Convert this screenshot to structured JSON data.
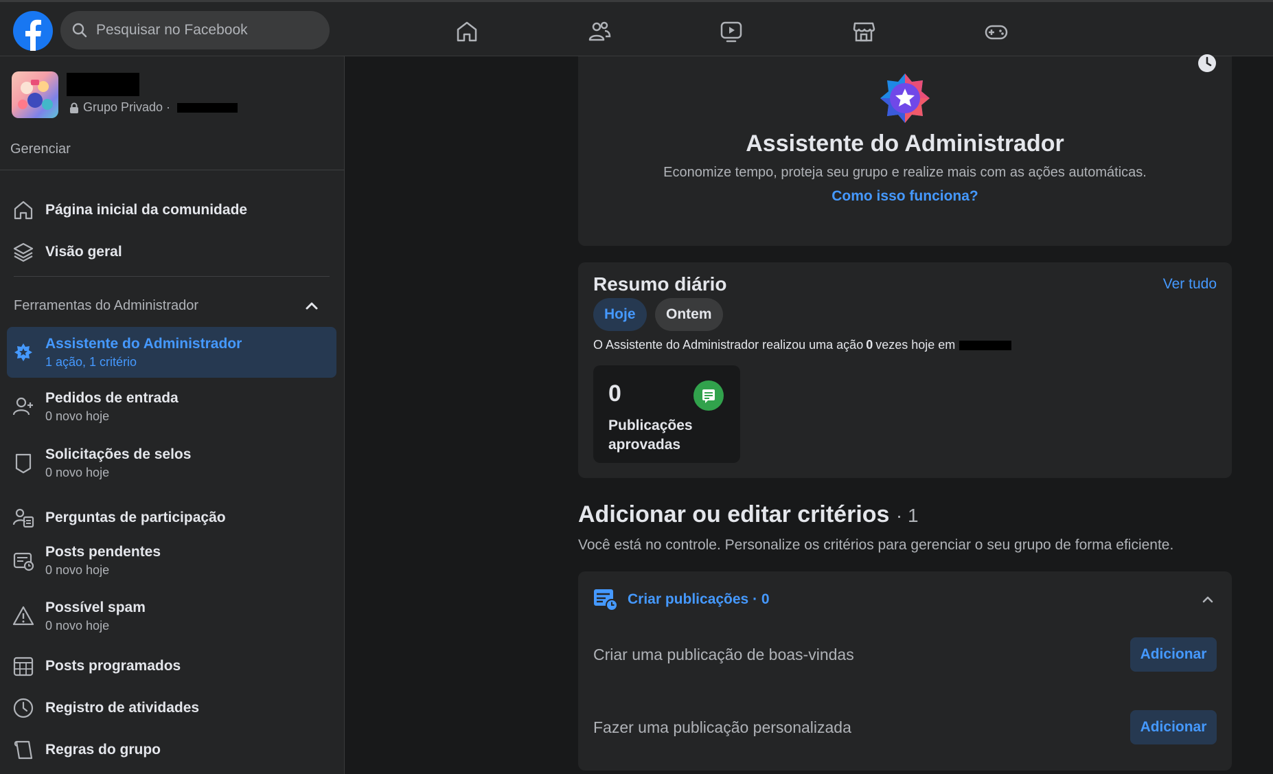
{
  "search": {
    "placeholder": "Pesquisar no Facebook"
  },
  "topnav": {
    "icons": [
      "home-icon",
      "friends-icon",
      "watch-icon",
      "marketplace-icon",
      "gaming-icon"
    ]
  },
  "group": {
    "privacy": "Grupo Privado ·"
  },
  "sidebar": {
    "manage_title": "Gerenciar",
    "top_items": [
      {
        "label": "Página inicial da comunidade",
        "icon": "home-icon"
      },
      {
        "label": "Visão geral",
        "icon": "layers-icon"
      }
    ],
    "admin_tools_title": "Ferramentas do Administrador",
    "admin_items": [
      {
        "label": "Assistente do Administrador",
        "sub": "1 ação, 1 critério",
        "icon": "admin-assistant-icon"
      },
      {
        "label": "Pedidos de entrada",
        "sub": "0 novo hoje",
        "icon": "person-add-icon"
      },
      {
        "label": "Solicitações de selos",
        "sub": "0 novo hoje",
        "icon": "badge-icon"
      },
      {
        "label": "Perguntas de participação",
        "icon": "questions-icon"
      },
      {
        "label": "Posts pendentes",
        "sub": "0 novo hoje",
        "icon": "pending-posts-icon"
      },
      {
        "label": "Possível spam",
        "sub": "0 novo hoje",
        "icon": "warning-icon"
      },
      {
        "label": "Posts programados",
        "icon": "calendar-icon"
      },
      {
        "label": "Registro de atividades",
        "icon": "clock-icon"
      },
      {
        "label": "Regras do grupo",
        "icon": "rules-icon"
      }
    ]
  },
  "assistant": {
    "title": "Assistente do Administrador",
    "description": "Economize tempo, proteja seu grupo e realize mais com as ações automáticas.",
    "link": "Como isso funciona?"
  },
  "summary": {
    "title": "Resumo diário",
    "see_all": "Ver tudo",
    "tabs": [
      "Hoje",
      "Ontem"
    ],
    "line_prefix": "O Assistente do Administrador realizou uma ação",
    "line_count": "0",
    "line_suffix": "vezes hoje em",
    "stat_value": "0",
    "stat_label": "Publicações aprovadas"
  },
  "criteria": {
    "title": "Adicionar ou editar critérios",
    "count": "· 1",
    "description": "Você está no controle. Personalize os critérios para gerenciar o seu grupo de forma eficiente."
  },
  "create_posts": {
    "header": "Criar publicações · 0",
    "rows": [
      {
        "label": "Criar uma publicação de boas-vindas",
        "button": "Adicionar"
      },
      {
        "label": "Fazer uma publicação personalizada",
        "button": "Adicionar"
      }
    ]
  },
  "colors": {
    "background": "#18191a",
    "surface": "#242526",
    "accent": "#4599ff",
    "accent_bg": "#263951",
    "facebook_blue": "#1877f2",
    "stat_green": "#31a24c"
  }
}
